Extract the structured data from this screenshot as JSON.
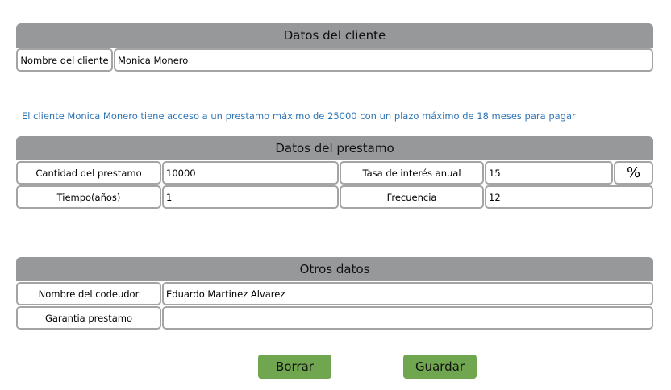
{
  "cliente": {
    "header": "Datos del cliente",
    "nombre_label": "Nombre del cliente",
    "nombre_value": "Monica Monero"
  },
  "info_message": "El cliente Monica Monero tiene acceso a un prestamo máximo de 25000 con un plazo máximo de 18 meses para pagar",
  "prestamo": {
    "header": "Datos del prestamo",
    "cantidad_label": "Cantidad del prestamo",
    "cantidad_value": "10000",
    "tasa_label": "Tasa de interés anual",
    "tasa_value": "15",
    "percent_symbol": "%",
    "tiempo_label": "Tiempo(años)",
    "tiempo_value": "1",
    "frecuencia_label": "Frecuencia",
    "frecuencia_value": "12"
  },
  "otros": {
    "header": "Otros datos",
    "codeudor_label": "Nombre del codeudor",
    "codeudor_value": "Eduardo Martinez Alvarez",
    "garantia_label": "Garantia prestamo",
    "garantia_value": ""
  },
  "buttons": {
    "borrar": "Borrar",
    "guardar": "Guardar"
  },
  "colors": {
    "header_bg": "#97989a",
    "button_bg": "#70a64f",
    "info_text": "#2e75b6",
    "border": "#a3a4a6"
  }
}
